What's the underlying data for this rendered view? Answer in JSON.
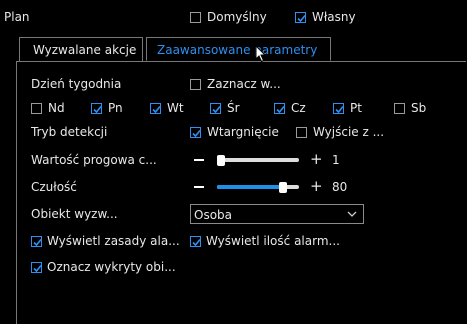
{
  "header": {
    "title": "Plan",
    "opt_default": {
      "label": "Domyślny",
      "checked": false
    },
    "opt_custom": {
      "label": "Własny",
      "checked": true
    }
  },
  "tabs": [
    {
      "label": "Wyzwalane akcje",
      "active": false
    },
    {
      "label": "Zaawansowane parametry",
      "active": true
    }
  ],
  "weekday": {
    "label": "Dzień tygodnia",
    "select_all": {
      "label": "Zaznacz w...",
      "checked": false
    },
    "days": [
      {
        "label": "Nd",
        "checked": false
      },
      {
        "label": "Pn",
        "checked": true
      },
      {
        "label": "Wt",
        "checked": true
      },
      {
        "label": "Śr",
        "checked": true
      },
      {
        "label": "Cz",
        "checked": true
      },
      {
        "label": "Pt",
        "checked": true
      },
      {
        "label": "Sb",
        "checked": false
      }
    ]
  },
  "detection_mode": {
    "label": "Tryb detekcji",
    "intrusion": {
      "label": "Wtargnięcie",
      "checked": true
    },
    "exit": {
      "label": "Wyjście z ...",
      "checked": false
    }
  },
  "threshold": {
    "label": "Wartość progowa c...",
    "value": "1",
    "fraction": 0.05
  },
  "sensitivity": {
    "label": "Czułość",
    "value": "80",
    "fraction": 0.8
  },
  "object": {
    "label": "Obiekt wyzw...",
    "selected": "Osoba"
  },
  "show_rules": {
    "label": "Wyświetl zasady ala...",
    "checked": true
  },
  "show_count": {
    "label": "Wyświetl ilość alarm...",
    "checked": true
  },
  "mark_objects": {
    "label": "Oznacz wykryty obi...",
    "checked": true
  },
  "colors": {
    "accent": "#2e8ff0",
    "background": "#000000"
  }
}
